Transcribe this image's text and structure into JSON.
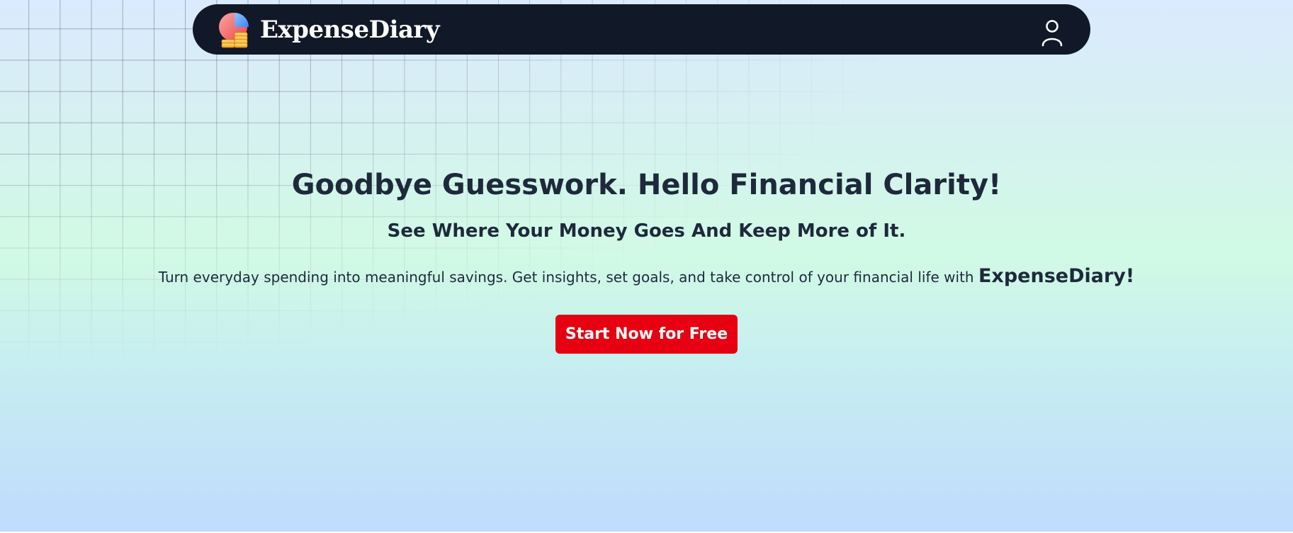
{
  "header": {
    "brand_name": "ExpenseDiary",
    "logo_icon": "pie-chart-coins-icon",
    "account_icon": "user-icon"
  },
  "hero": {
    "headline": "Goodbye Guesswork. Hello Financial Clarity!",
    "subheadline": "See Where Your Money Goes And Keep More of It.",
    "description": "Turn everyday spending into meaningful savings. Get insights, set goals, and take control of your financial life with",
    "description_brand": "ExpenseDiary!",
    "cta_label": "Start Now for Free"
  },
  "colors": {
    "navbar_bg": "#111827",
    "text_primary": "#1e293b",
    "cta_bg": "#e60012",
    "cta_text": "#ffffff"
  }
}
